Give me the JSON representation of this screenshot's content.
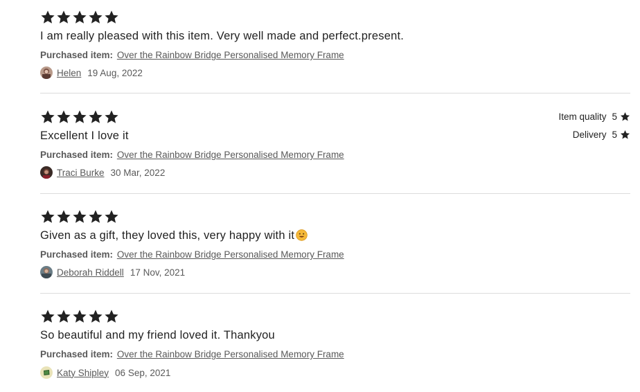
{
  "reviews": [
    {
      "rating": 5,
      "text": "I am really pleased with this item. Very well made and perfect.present.",
      "purchased_label": "Purchased item:",
      "item": "Over the Rainbow Bridge Personalised Memory Frame",
      "author": "Helen",
      "date": "19 Aug, 2022"
    },
    {
      "rating": 5,
      "text": "Excellent I love it",
      "purchased_label": "Purchased item:",
      "item": "Over the Rainbow Bridge Personalised Memory Frame",
      "author": "Traci Burke",
      "date": "30 Mar, 2022",
      "sub_ratings": [
        {
          "label": "Item quality",
          "value": "5"
        },
        {
          "label": "Delivery",
          "value": "5"
        }
      ]
    },
    {
      "rating": 5,
      "text": "Given as a gift, they loved this, very happy with it",
      "emoji": "smiley-emoji",
      "purchased_label": "Purchased item:",
      "item": "Over the Rainbow Bridge Personalised Memory Frame",
      "author": "Deborah Riddell",
      "date": "17 Nov, 2021"
    },
    {
      "rating": 5,
      "text": "So beautiful and my friend loved it. Thankyou",
      "purchased_label": "Purchased item:",
      "item": "Over the Rainbow Bridge Personalised Memory Frame",
      "author": "Katy Shipley",
      "date": "06 Sep, 2021"
    }
  ],
  "colors": {
    "star": "#222222",
    "muted_text": "#595959",
    "divider": "#dcdcdc",
    "emoji": "#f5b93a"
  }
}
